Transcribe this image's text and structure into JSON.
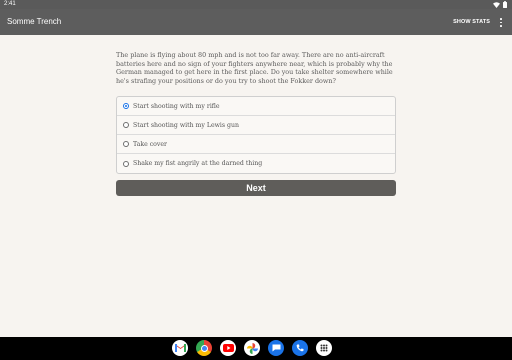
{
  "status_bar": {
    "time": "2:41",
    "icons": [
      "wifi-icon",
      "battery-icon"
    ]
  },
  "app_bar": {
    "title": "Somme Trench",
    "show_stats_label": "SHOW STATS",
    "overflow_icon": "more-vert-icon"
  },
  "story": {
    "text": "The plane is flying about 80 mph and is not too far away. There are no anti-aircraft batteries here and no sign of your fighters anywhere near, which is probably why the German managed to get here in the first place. Do you take shelter somewhere while he's strafing your positions or do you try to shoot the Fokker down?"
  },
  "choices": [
    {
      "label": "Start shooting with my rifle",
      "selected": true
    },
    {
      "label": "Start shooting with my Lewis gun",
      "selected": false
    },
    {
      "label": "Take cover",
      "selected": false
    },
    {
      "label": "Shake my fist angrily at the darned thing",
      "selected": false
    }
  ],
  "next_label": "Next",
  "taskbar": {
    "apps": [
      "gmail-icon",
      "chrome-icon",
      "youtube-icon",
      "photos-icon",
      "messages-icon",
      "phone-icon",
      "app-drawer-icon"
    ]
  },
  "colors": {
    "app_bar": "#5d5d5d",
    "background": "#f7f4f0",
    "accent": "#1a73e8",
    "next_button": "#5f5d5a"
  }
}
